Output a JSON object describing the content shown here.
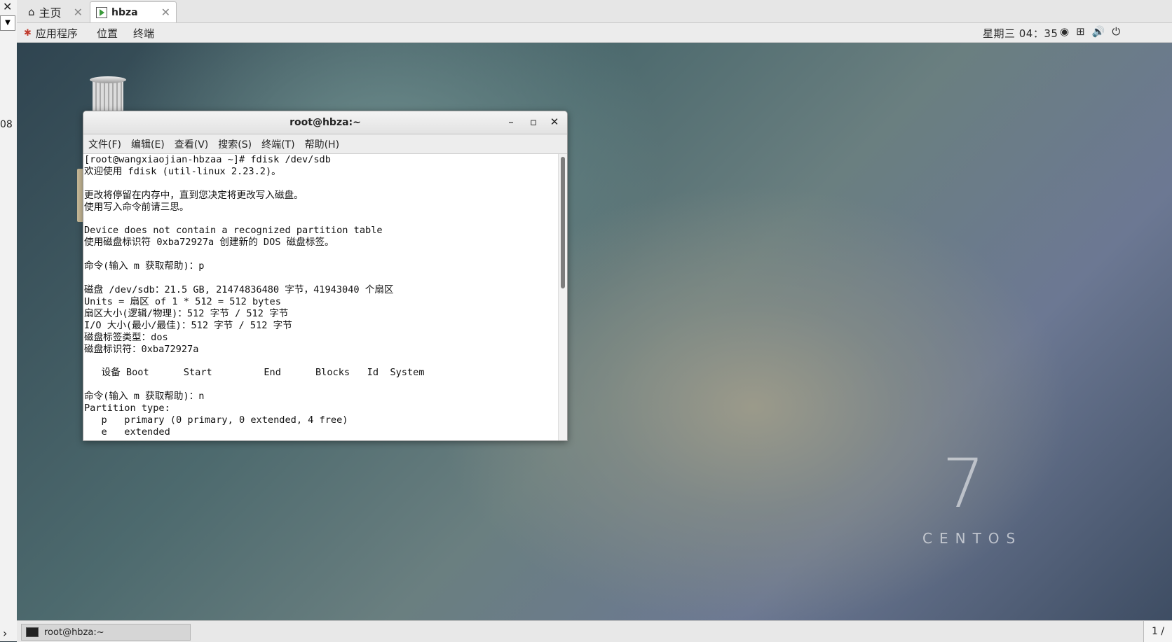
{
  "host": {
    "close_glyph": "✕",
    "left_number": "08",
    "tabs": [
      {
        "label": "主页",
        "icon": "home-icon"
      },
      {
        "label": "hbza",
        "icon": "vm-icon"
      }
    ],
    "tab_close": "✕"
  },
  "panel": {
    "apps": "应用程序",
    "places": "位置",
    "terminal": "终端",
    "clock": "星期三 04：35",
    "tray_icons": [
      "accessibility-icon",
      "network-icon",
      "volume-icon",
      "power-icon"
    ]
  },
  "desktop": {
    "brand_number": "7",
    "brand_text": "CENTOS"
  },
  "terminal": {
    "title": "root@hbza:~",
    "menu": [
      "文件(F)",
      "编辑(E)",
      "查看(V)",
      "搜索(S)",
      "终端(T)",
      "帮助(H)"
    ],
    "lines": [
      "[root@wangxiaojian-hbzaa ~]# fdisk /dev/sdb",
      "欢迎使用 fdisk (util-linux 2.23.2)。",
      "",
      "更改将停留在内存中，直到您决定将更改写入磁盘。",
      "使用写入命令前请三思。",
      "",
      "Device does not contain a recognized partition table",
      "使用磁盘标识符 0xba72927a 创建新的 DOS 磁盘标签。",
      "",
      "命令(输入 m 获取帮助)：p",
      "",
      "磁盘 /dev/sdb：21.5 GB, 21474836480 字节，41943040 个扇区",
      "Units = 扇区 of 1 * 512 = 512 bytes",
      "扇区大小(逻辑/物理)：512 字节 / 512 字节",
      "I/O 大小(最小/最佳)：512 字节 / 512 字节",
      "磁盘标签类型：dos",
      "磁盘标识符：0xba72927a",
      "",
      "   设备 Boot      Start         End      Blocks   Id  System",
      "",
      "命令(输入 m 获取帮助)：n",
      "Partition type:",
      "   p   primary (0 primary, 0 extended, 4 free)",
      "   e   extended"
    ]
  },
  "taskbar": {
    "item": "root@hbza:~",
    "pager": "1 /"
  }
}
